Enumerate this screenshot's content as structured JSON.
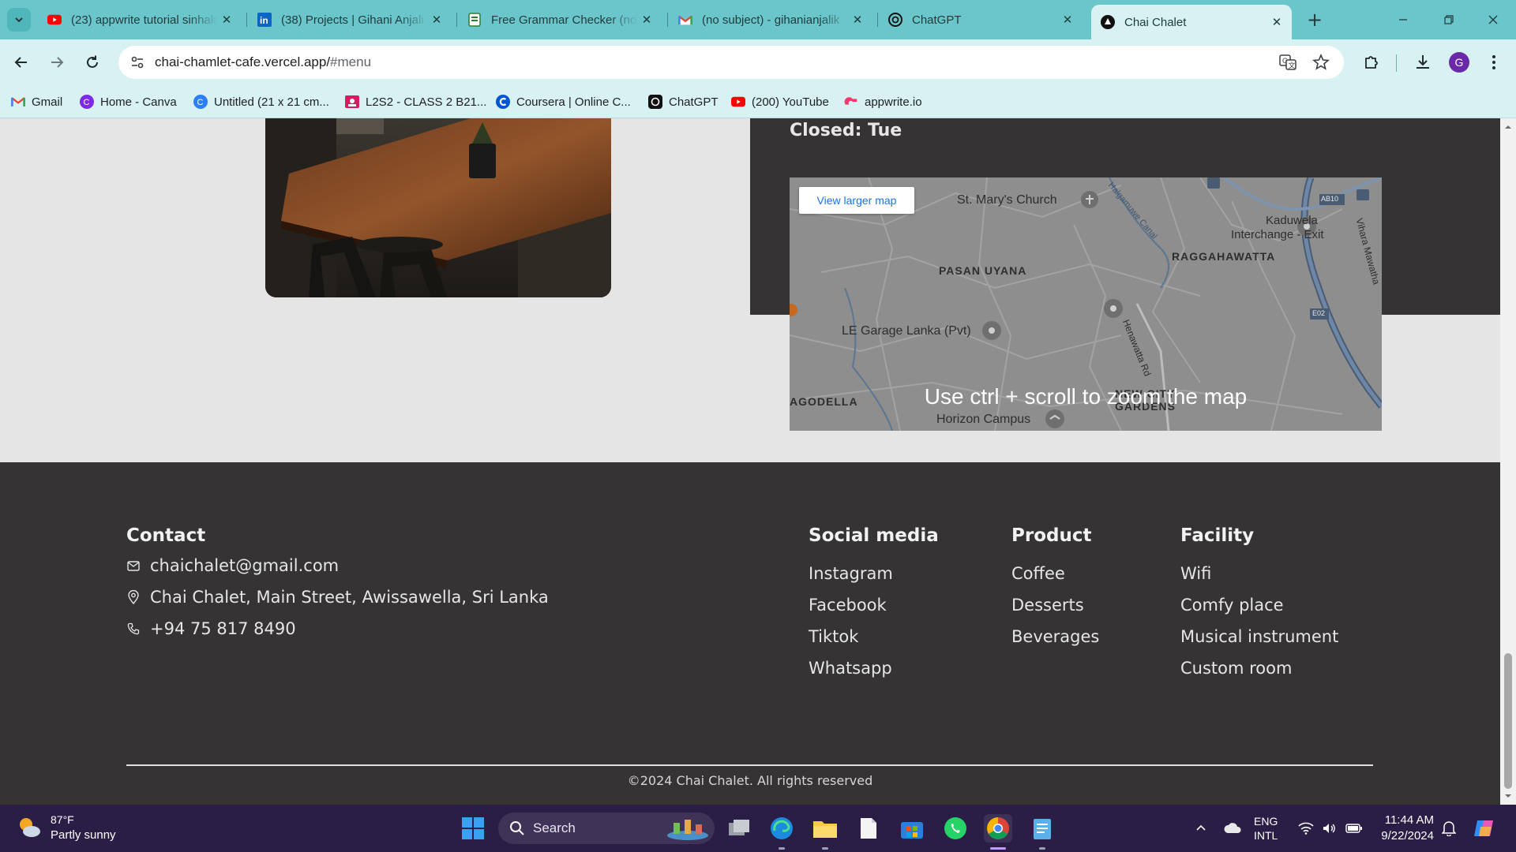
{
  "browser": {
    "tabs": [
      {
        "label": "(23) appwrite tutorial sinhala",
        "icon": "youtube-icon"
      },
      {
        "label": "(38) Projects | Gihani Anjali",
        "icon": "linkedin-icon"
      },
      {
        "label": "Free Grammar Checker (no",
        "icon": "grammar-icon"
      },
      {
        "label": "(no subject) - gihanianjalik",
        "icon": "gmail-icon"
      },
      {
        "label": "ChatGPT",
        "icon": "chatgpt-icon"
      },
      {
        "label": "Chai Chalet",
        "icon": "site-icon"
      }
    ],
    "url": {
      "host": "chai-chamlet-cafe.vercel.app/",
      "path": "#menu"
    },
    "profile_initial": "G",
    "bookmarks": [
      {
        "label": "Gmail",
        "icon": "gmail-icon"
      },
      {
        "label": "Home - Canva",
        "icon": "canva-icon"
      },
      {
        "label": "Untitled (21 x 21 cm...",
        "icon": "canva-icon"
      },
      {
        "label": "L2S2 - CLASS 2 B21...",
        "icon": "classroom-icon"
      },
      {
        "label": "Coursera | Online C...",
        "icon": "coursera-icon"
      },
      {
        "label": "ChatGPT",
        "icon": "chatgpt-icon"
      },
      {
        "label": "(200) YouTube",
        "icon": "youtube-icon"
      },
      {
        "label": "appwrite.io",
        "icon": "appwrite-icon"
      }
    ]
  },
  "hours": {
    "closed_label": "Closed:",
    "closed_value": "Tue"
  },
  "map": {
    "button": "View larger map",
    "hint": "Use ctrl + scroll to zoom the map",
    "labels": [
      "St. Mary's Church",
      "Kaduwela",
      "Interchange - Exit",
      "RAGGAHAWATTA",
      "PASAN UYANA",
      "LE Garage Lanka (Pvt)",
      "AGODELLA",
      "NEW CITY",
      "GARDENS",
      "Horizon Campus",
      "AB10",
      "E02",
      "Henawatta Rd",
      "Vihara Mawatha",
      "Halgamuwe Canal"
    ]
  },
  "footer": {
    "contact": {
      "heading": "Contact",
      "email": "chaichalet@gmail.com",
      "address": "Chai Chalet, Main Street, Awissawella, Sri Lanka",
      "phone": "+94 75 817 8490"
    },
    "social": {
      "heading": "Social media",
      "items": [
        "Instagram",
        "Facebook",
        "Tiktok",
        "Whatsapp"
      ]
    },
    "product": {
      "heading": "Product",
      "items": [
        "Coffee",
        "Desserts",
        "Beverages"
      ]
    },
    "facility": {
      "heading": "Facility",
      "items": [
        "Wifi",
        "Comfy place",
        "Musical instrument",
        "Custom room"
      ]
    },
    "copyright": "©2024 Chai Chalet. All rights reserved"
  },
  "taskbar": {
    "weather_temp": "87°F",
    "weather_cond": "Partly sunny",
    "search": "Search",
    "lang_line1": "ENG",
    "lang_line2": "INTL",
    "time": "11:44 AM",
    "date": "9/22/2024"
  },
  "colors": {
    "tabstrip": "#6bc6cb",
    "toolbar": "#d8f1f2",
    "footer": "#353333",
    "page": "#e5e5e5",
    "taskbar": "#2a1e46"
  }
}
